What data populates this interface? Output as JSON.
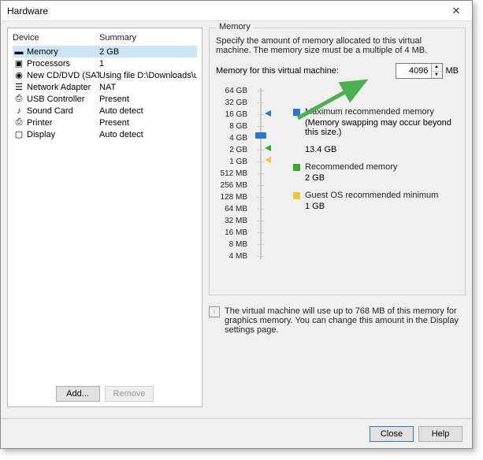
{
  "window": {
    "title": "Hardware"
  },
  "deviceList": {
    "headers": {
      "device": "Device",
      "summary": "Summary"
    },
    "items": [
      {
        "name": "Memory",
        "summary": "2 GB",
        "icon": "memory-icon",
        "selected": true
      },
      {
        "name": "Processors",
        "summary": "1",
        "icon": "cpu-icon"
      },
      {
        "name": "New CD/DVD (SATA)",
        "summary": "Using file D:\\Downloads\\ubu...",
        "icon": "cd-icon"
      },
      {
        "name": "Network Adapter",
        "summary": "NAT",
        "icon": "net-icon"
      },
      {
        "name": "USB Controller",
        "summary": "Present",
        "icon": "usb-icon"
      },
      {
        "name": "Sound Card",
        "summary": "Auto detect",
        "icon": "sound-icon"
      },
      {
        "name": "Printer",
        "summary": "Present",
        "icon": "printer-icon"
      },
      {
        "name": "Display",
        "summary": "Auto detect",
        "icon": "display-icon"
      }
    ],
    "buttons": {
      "add": "Add...",
      "remove": "Remove"
    }
  },
  "memoryPanel": {
    "legend": "Memory",
    "desc": "Specify the amount of memory allocated to this virtual machine. The memory size must be a multiple of 4 MB.",
    "inputLabel": "Memory for this virtual machine:",
    "inputValue": "4096",
    "unit": "MB",
    "ticks": [
      "64 GB",
      "32 GB",
      "16 GB",
      "8 GB",
      "4 GB",
      "2 GB",
      "1 GB",
      "512 MB",
      "256 MB",
      "128 MB",
      "64 MB",
      "32 MB",
      "16 MB",
      "8 MB",
      "4 MB"
    ],
    "legendItems": {
      "max": {
        "label": "Maximum recommended memory",
        "note": "(Memory swapping may occur beyond this size.)",
        "value": "13.4 GB"
      },
      "rec": {
        "label": "Recommended memory",
        "value": "2 GB"
      },
      "min": {
        "label": "Guest OS recommended minimum",
        "value": "1 GB"
      }
    },
    "graphicsNote": "The virtual machine will use up to 768 MB of this memory for graphics memory. You can change this amount in the Display settings page."
  },
  "footer": {
    "close": "Close",
    "help": "Help"
  }
}
